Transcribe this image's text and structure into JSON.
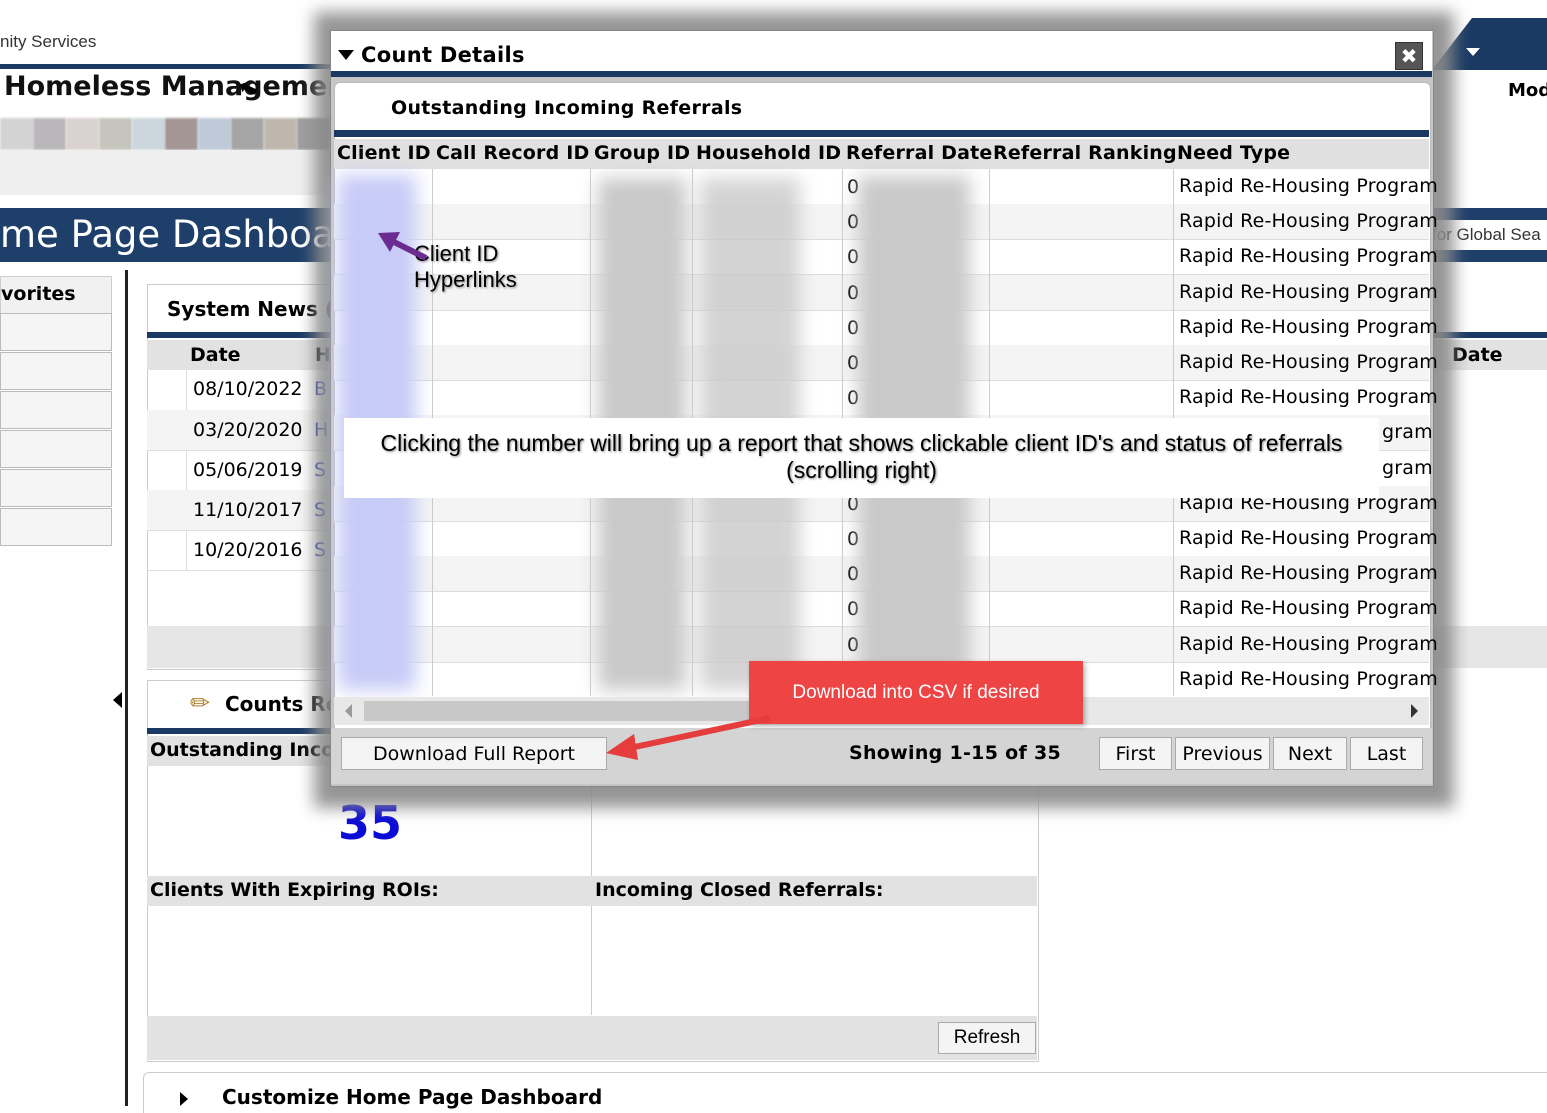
{
  "header": {
    "agency": "nity Services",
    "app_title": "Homeless Management I",
    "module_label": "Mod",
    "dashboard_title": "me Page Dashboard",
    "global_search_placeholder": "for Global Sea"
  },
  "sidebar": {
    "favorites_label": "vorites"
  },
  "system_news": {
    "title": "System News (",
    "col_date": "Date",
    "col_h": "H",
    "right_col_date": "Date",
    "rows": [
      {
        "date": "08/10/2022",
        "link": "B"
      },
      {
        "date": "03/20/2020",
        "link": "H"
      },
      {
        "date": "05/06/2019",
        "link": "S"
      },
      {
        "date": "11/10/2017",
        "link": "S"
      },
      {
        "date": "10/20/2016",
        "link": "S"
      }
    ]
  },
  "counts": {
    "title": "Counts Re",
    "outstanding_label": "Outstanding Inco",
    "outstanding_value": "35",
    "expiring_label": "Clients With Expiring ROIs:",
    "closed_label": "Incoming Closed Referrals:",
    "refresh_label": "Refresh"
  },
  "customize": {
    "title": "Customize Home Page Dashboard"
  },
  "modal": {
    "title": "Count Details",
    "close_glyph": "✖",
    "subtitle": "Outstanding Incoming Referrals",
    "columns": [
      "Client ID",
      "Call Record ID",
      "Group ID",
      "Household ID",
      "Referral Date",
      "Referral Ranking",
      "Need Type"
    ],
    "need_type_value": "Rapid Re-Housing Program",
    "need_type_partial": "gram",
    "date_prefix": "0",
    "row_count": 15,
    "download_label": "Download Full Report",
    "showing": "Showing 1-15 of 35",
    "pager": [
      "First",
      "Previous",
      "Next",
      "Last"
    ]
  },
  "annotations": {
    "client_id": "Client ID Hyperlinks",
    "clicking": "Clicking the number will bring up a report that shows clickable client ID's and status of referrals (scrolling right)",
    "csv": "Download into CSV if desired"
  },
  "colors": {
    "navy": "#1b3a63",
    "count_blue": "#0b0bd6",
    "callout_red": "#ee4444",
    "annotation_arrow_purple": "#6a2c91"
  }
}
